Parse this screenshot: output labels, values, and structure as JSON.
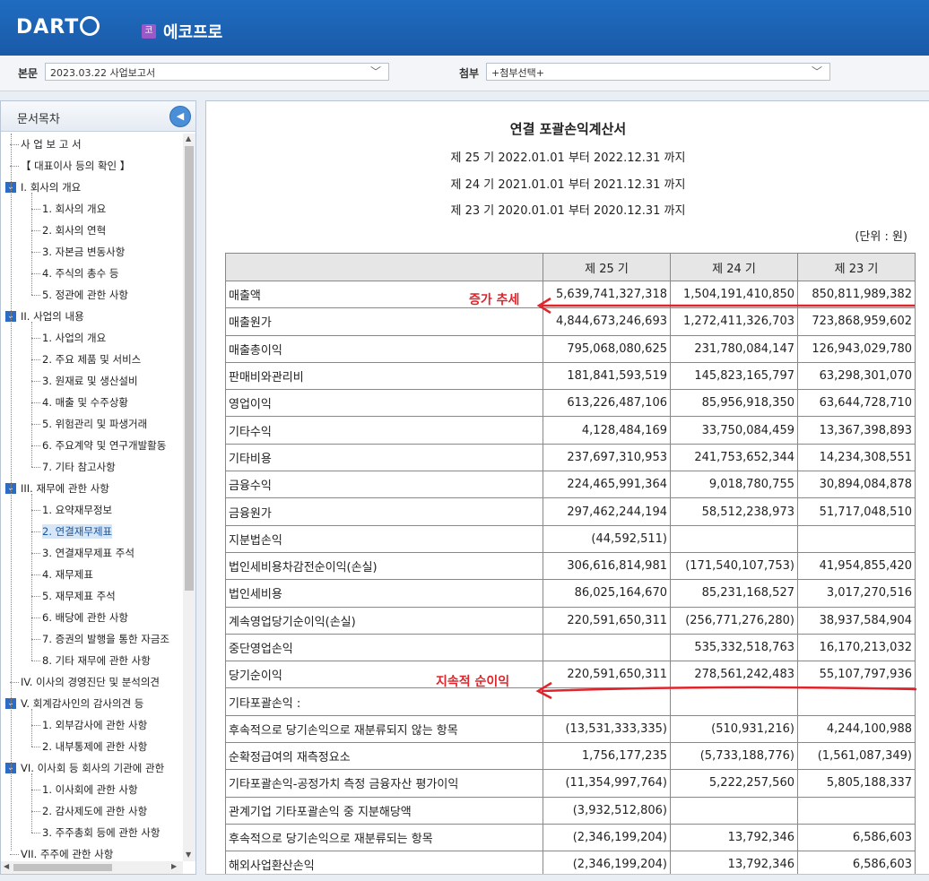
{
  "header": {
    "logo": "DART",
    "corp_badge": "코",
    "corp_name": "에코프로"
  },
  "toolbar": {
    "main_label": "본문",
    "main_value": "2023.03.22  사업보고서",
    "attach_label": "첨부",
    "attach_value": "+첨부선택+"
  },
  "sidebar": {
    "title": "문서목차",
    "items": [
      "사 업 보 고 서",
      "【 대표이사 등의 확인 】",
      "I. 회사의 개요",
      "1. 회사의 개요",
      "2. 회사의 연혁",
      "3. 자본금 변동사항",
      "4. 주식의 총수 등",
      "5. 정관에 관한 사항",
      "II. 사업의 내용",
      "1. 사업의 개요",
      "2. 주요 제품 및 서비스",
      "3. 원재료 및 생산설비",
      "4. 매출 및 수주상황",
      "5. 위험관리 및 파생거래",
      "6. 주요계약 및 연구개발활동",
      "7. 기타 참고사항",
      "III. 재무에 관한 사항",
      "1. 요약재무정보",
      "2. 연결재무제표",
      "3. 연결재무제표 주석",
      "4. 재무제표",
      "5. 재무제표 주석",
      "6. 배당에 관한 사항",
      "7. 증권의 발행을 통한 자금조",
      "8. 기타 재무에 관한 사항",
      "IV. 이사의 경영진단 및 분석의견",
      "V. 회계감사인의 감사의견 등",
      "1. 외부감사에 관한 사항",
      "2. 내부통제에 관한 사항",
      "VI. 이사회 등 회사의 기관에 관한",
      "1. 이사회에 관한 사항",
      "2. 감사제도에 관한 사항",
      "3. 주주총회 등에 관한 사항",
      "VII. 주주에 관한 사항"
    ]
  },
  "document": {
    "title": "연결 포괄손익계산서",
    "periods": [
      "제 25 기 2022.01.01 부터 2022.12.31 까지",
      "제 24 기 2021.01.01 부터 2021.12.31 까지",
      "제 23 기 2020.01.01 부터 2020.12.31 까지"
    ],
    "unit": "(단위 : 원)",
    "columns": [
      "",
      "제 25 기",
      "제 24 기",
      "제 23 기"
    ],
    "rows": [
      [
        "매출액",
        "5,639,741,327,318",
        "1,504,191,410,850",
        "850,811,989,382"
      ],
      [
        "매출원가",
        "4,844,673,246,693",
        "1,272,411,326,703",
        "723,868,959,602"
      ],
      [
        "매출총이익",
        "795,068,080,625",
        "231,780,084,147",
        "126,943,029,780"
      ],
      [
        " 판매비와관리비",
        "181,841,593,519",
        "145,823,165,797",
        "63,298,301,070"
      ],
      [
        "영업이익",
        "613,226,487,106",
        "85,956,918,350",
        "63,644,728,710"
      ],
      [
        " 기타수익",
        "4,128,484,169",
        "33,750,084,459",
        "13,367,398,893"
      ],
      [
        " 기타비용",
        "237,697,310,953",
        "241,753,652,344",
        "14,234,308,551"
      ],
      [
        " 금융수익",
        "224,465,991,364",
        "9,018,780,755",
        "30,894,084,878"
      ],
      [
        " 금융원가",
        "297,462,244,194",
        "58,512,238,973",
        "51,717,048,510"
      ],
      [
        " 지분법손익",
        "(44,592,511)",
        "",
        ""
      ],
      [
        "법인세비용차감전순이익(손실)",
        "306,616,814,981",
        "(171,540,107,753)",
        "41,954,855,420"
      ],
      [
        " 법인세비용",
        "86,025,164,670",
        "85,231,168,527",
        "3,017,270,516"
      ],
      [
        "계속영업당기순이익(손실)",
        "220,591,650,311",
        "(256,771,276,280)",
        "38,937,584,904"
      ],
      [
        "중단영업손익",
        "",
        "535,332,518,763",
        "16,170,213,032"
      ],
      [
        "당기순이익",
        "220,591,650,311",
        "278,561,242,483",
        "55,107,797,936"
      ],
      [
        "기타포괄손익 :",
        "",
        "",
        ""
      ],
      [
        " 후속적으로 당기손익으로 재분류되지 않는 항목",
        "(13,531,333,335)",
        "(510,931,216)",
        "4,244,100,988"
      ],
      [
        "   순확정급여의 재측정요소",
        "1,756,177,235",
        "(5,733,188,776)",
        "(1,561,087,349)"
      ],
      [
        "   기타포괄손익-공정가치 측정 금융자산 평가이익",
        "(11,354,997,764)",
        "5,222,257,560",
        "5,805,188,337"
      ],
      [
        "   관계기업 기타포괄손익 중 지분해당액",
        "(3,932,512,806)",
        "",
        ""
      ],
      [
        " 후속적으로 당기손익으로 재분류되는 항목",
        "(2,346,199,204)",
        "13,792,346",
        "6,586,603"
      ],
      [
        "   해외사업환산손익",
        "(2,346,199,204)",
        "13,792,346",
        "6,586,603"
      ]
    ]
  },
  "annotations": {
    "increase_trend": "증가 추세",
    "sustained_profit": "지속적 순이익",
    "color": "#e0242b"
  }
}
